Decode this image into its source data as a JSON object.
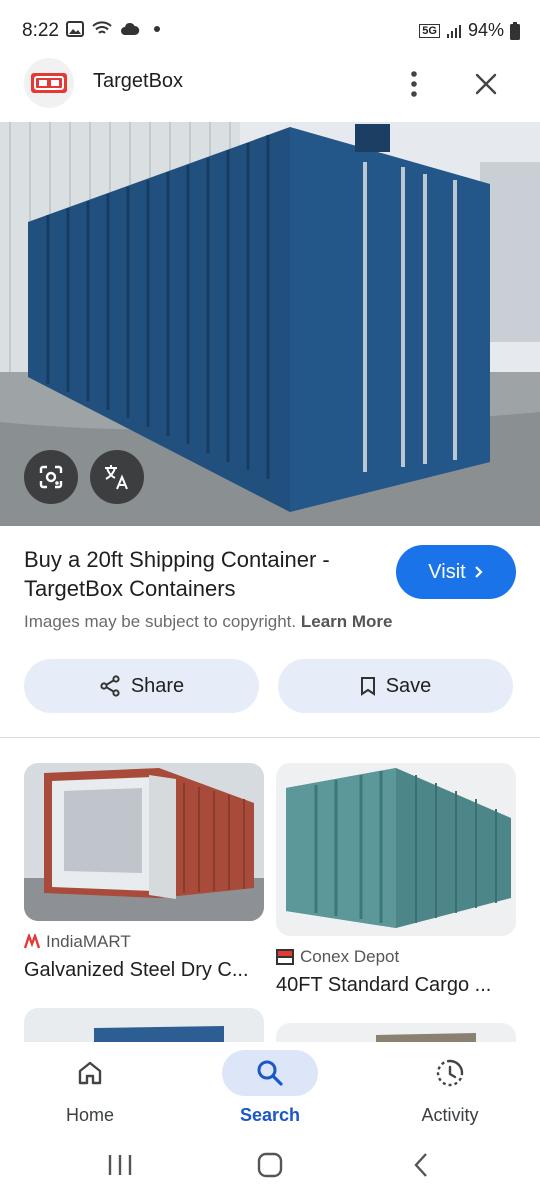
{
  "status_bar": {
    "time": "8:22",
    "network": "5G",
    "battery": "94%"
  },
  "header": {
    "site_name": "TargetBox"
  },
  "result": {
    "title": "Buy a 20ft Shipping Container - TargetBox Containers",
    "visit_label": "Visit",
    "copyright_text": "Images may be subject to copyright.",
    "learn_more": "Learn More",
    "share_label": "Share",
    "save_label": "Save"
  },
  "related": [
    {
      "source": "IndiaMART",
      "title": "Galvanized Steel Dry C..."
    },
    {
      "source": "Conex Depot",
      "title": "40FT Standard Cargo ..."
    }
  ],
  "bottom_nav": [
    {
      "label": "Home",
      "icon": "home-icon"
    },
    {
      "label": "Search",
      "icon": "search-icon",
      "active": true
    },
    {
      "label": "Activity",
      "icon": "activity-icon"
    }
  ],
  "colors": {
    "accent": "#1a73e8",
    "chip_bg": "#e6edf9",
    "active_nav_bg": "#dde6f8",
    "container_blue": "#1f4f7d"
  }
}
